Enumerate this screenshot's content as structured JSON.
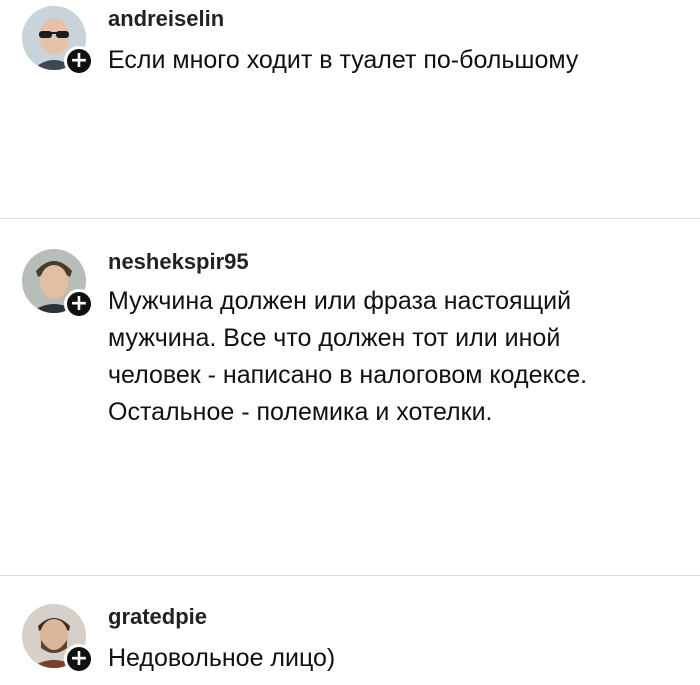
{
  "comments": [
    {
      "username": "andreiselin",
      "text": "Если много ходит в туалет по-большому",
      "avatar": "avatar-man-sunglasses"
    },
    {
      "username": "neshekspіr95",
      "text": "Мужчина должен или фраза настоящий\nмужчина. Все что должен тот или иной\nчеловек - написано в налоговом кодексе.\nОстальное - полемика и хотелки.",
      "avatar": "avatar-young-man"
    },
    {
      "username": "gratedpie",
      "text": "Недовольное лицо)",
      "avatar": "avatar-bearded-man"
    }
  ],
  "follow_badge_symbol": "+",
  "colors": {
    "text": "#111111",
    "divider": "#dcdcdc",
    "badge": "#111111"
  }
}
